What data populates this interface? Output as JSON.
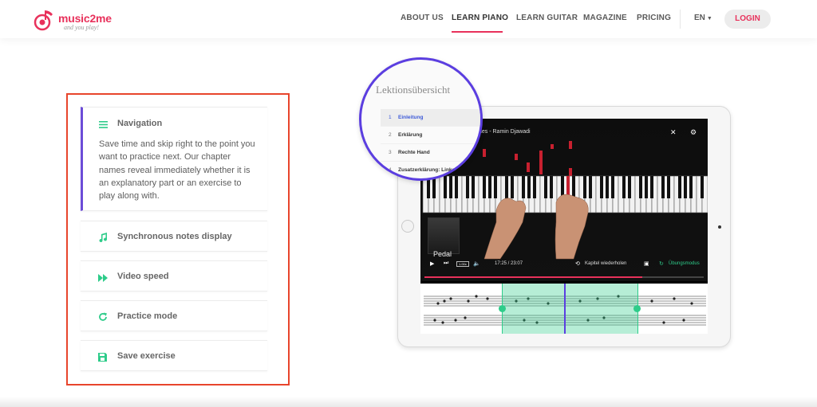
{
  "logo": {
    "name": "music2me",
    "tagline": "and you play!"
  },
  "nav": {
    "items": [
      "ABOUT US",
      "LEARN PIANO",
      "LEARN GUITAR",
      "MAGAZINE",
      "PRICING"
    ],
    "language": "EN",
    "login": "LOGIN"
  },
  "features": [
    {
      "title": "Navigation",
      "icon": "list-icon",
      "text": "Save time and skip right to the point you want to practice next. Our chapter names reveal immediately whether it is an explanatory part or an exercise to play along with."
    },
    {
      "title": "Synchronous notes display",
      "icon": "music-note-icon"
    },
    {
      "title": "Video speed",
      "icon": "fast-forward-icon"
    },
    {
      "title": "Practice mode",
      "icon": "redo-icon"
    },
    {
      "title": "Save exercise",
      "icon": "save-icon"
    }
  ],
  "player": {
    "title": "nes - Ramin Djawadi",
    "pedal_label": "Pedal",
    "time": "17:25 / 23:07",
    "speed": "1.00x",
    "repeat_label": "Kapitel wiederholen",
    "practice_label": "Übungsmodus",
    "progress": 0.78
  },
  "lessons": {
    "title": "Lektionsübersicht",
    "items": [
      {
        "num": "1",
        "label": "Einleitung"
      },
      {
        "num": "2",
        "label": "Erklärung"
      },
      {
        "num": "3",
        "label": "Rechte Hand"
      },
      {
        "num": "4",
        "label": "Zusatzerklärung: Linke H"
      }
    ]
  },
  "colors": {
    "brand": "#e8315b",
    "accent": "#2ecc8a",
    "highlight": "#5b3ee0",
    "box_border": "#e8452c"
  }
}
